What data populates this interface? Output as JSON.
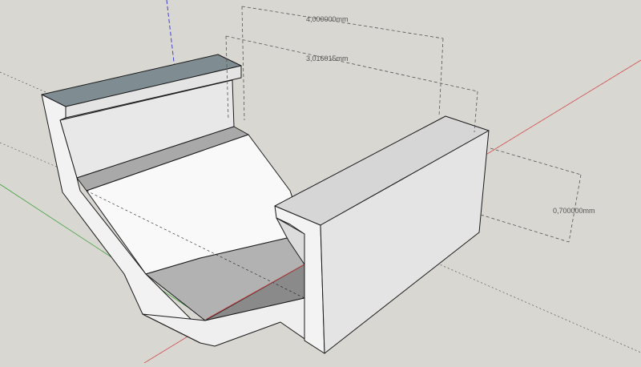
{
  "app": {
    "name": "SketchUp"
  },
  "colors": {
    "background": "#d9d7d2",
    "axis_red": "#d04a4a",
    "axis_green": "#3fa03f",
    "axis_blue": "#2f2fd0",
    "model_face_light": "#f4f4f4",
    "model_face_mid": "#e4e4e4",
    "model_face_dark": "#a9a9a9",
    "model_top_dark": "#7f8c91",
    "edge": "#1a1a1a",
    "dimension": "#555555"
  },
  "dimensions": {
    "top_length": "4,000000mm",
    "inner_length": "3,016015mm",
    "wall_height": "0,700000mm"
  }
}
